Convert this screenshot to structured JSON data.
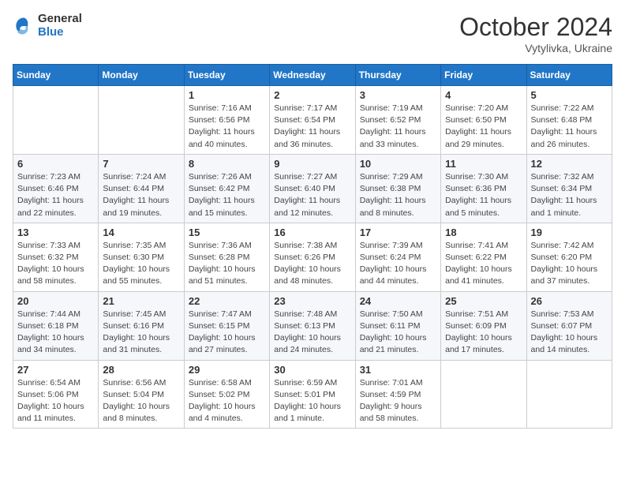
{
  "header": {
    "logo_general": "General",
    "logo_blue": "Blue",
    "month": "October 2024",
    "location": "Vytylivka, Ukraine"
  },
  "days_of_week": [
    "Sunday",
    "Monday",
    "Tuesday",
    "Wednesday",
    "Thursday",
    "Friday",
    "Saturday"
  ],
  "weeks": [
    [
      {
        "day": "",
        "info": ""
      },
      {
        "day": "",
        "info": ""
      },
      {
        "day": "1",
        "info": "Sunrise: 7:16 AM\nSunset: 6:56 PM\nDaylight: 11 hours and 40 minutes."
      },
      {
        "day": "2",
        "info": "Sunrise: 7:17 AM\nSunset: 6:54 PM\nDaylight: 11 hours and 36 minutes."
      },
      {
        "day": "3",
        "info": "Sunrise: 7:19 AM\nSunset: 6:52 PM\nDaylight: 11 hours and 33 minutes."
      },
      {
        "day": "4",
        "info": "Sunrise: 7:20 AM\nSunset: 6:50 PM\nDaylight: 11 hours and 29 minutes."
      },
      {
        "day": "5",
        "info": "Sunrise: 7:22 AM\nSunset: 6:48 PM\nDaylight: 11 hours and 26 minutes."
      }
    ],
    [
      {
        "day": "6",
        "info": "Sunrise: 7:23 AM\nSunset: 6:46 PM\nDaylight: 11 hours and 22 minutes."
      },
      {
        "day": "7",
        "info": "Sunrise: 7:24 AM\nSunset: 6:44 PM\nDaylight: 11 hours and 19 minutes."
      },
      {
        "day": "8",
        "info": "Sunrise: 7:26 AM\nSunset: 6:42 PM\nDaylight: 11 hours and 15 minutes."
      },
      {
        "day": "9",
        "info": "Sunrise: 7:27 AM\nSunset: 6:40 PM\nDaylight: 11 hours and 12 minutes."
      },
      {
        "day": "10",
        "info": "Sunrise: 7:29 AM\nSunset: 6:38 PM\nDaylight: 11 hours and 8 minutes."
      },
      {
        "day": "11",
        "info": "Sunrise: 7:30 AM\nSunset: 6:36 PM\nDaylight: 11 hours and 5 minutes."
      },
      {
        "day": "12",
        "info": "Sunrise: 7:32 AM\nSunset: 6:34 PM\nDaylight: 11 hours and 1 minute."
      }
    ],
    [
      {
        "day": "13",
        "info": "Sunrise: 7:33 AM\nSunset: 6:32 PM\nDaylight: 10 hours and 58 minutes."
      },
      {
        "day": "14",
        "info": "Sunrise: 7:35 AM\nSunset: 6:30 PM\nDaylight: 10 hours and 55 minutes."
      },
      {
        "day": "15",
        "info": "Sunrise: 7:36 AM\nSunset: 6:28 PM\nDaylight: 10 hours and 51 minutes."
      },
      {
        "day": "16",
        "info": "Sunrise: 7:38 AM\nSunset: 6:26 PM\nDaylight: 10 hours and 48 minutes."
      },
      {
        "day": "17",
        "info": "Sunrise: 7:39 AM\nSunset: 6:24 PM\nDaylight: 10 hours and 44 minutes."
      },
      {
        "day": "18",
        "info": "Sunrise: 7:41 AM\nSunset: 6:22 PM\nDaylight: 10 hours and 41 minutes."
      },
      {
        "day": "19",
        "info": "Sunrise: 7:42 AM\nSunset: 6:20 PM\nDaylight: 10 hours and 37 minutes."
      }
    ],
    [
      {
        "day": "20",
        "info": "Sunrise: 7:44 AM\nSunset: 6:18 PM\nDaylight: 10 hours and 34 minutes."
      },
      {
        "day": "21",
        "info": "Sunrise: 7:45 AM\nSunset: 6:16 PM\nDaylight: 10 hours and 31 minutes."
      },
      {
        "day": "22",
        "info": "Sunrise: 7:47 AM\nSunset: 6:15 PM\nDaylight: 10 hours and 27 minutes."
      },
      {
        "day": "23",
        "info": "Sunrise: 7:48 AM\nSunset: 6:13 PM\nDaylight: 10 hours and 24 minutes."
      },
      {
        "day": "24",
        "info": "Sunrise: 7:50 AM\nSunset: 6:11 PM\nDaylight: 10 hours and 21 minutes."
      },
      {
        "day": "25",
        "info": "Sunrise: 7:51 AM\nSunset: 6:09 PM\nDaylight: 10 hours and 17 minutes."
      },
      {
        "day": "26",
        "info": "Sunrise: 7:53 AM\nSunset: 6:07 PM\nDaylight: 10 hours and 14 minutes."
      }
    ],
    [
      {
        "day": "27",
        "info": "Sunrise: 6:54 AM\nSunset: 5:06 PM\nDaylight: 10 hours and 11 minutes."
      },
      {
        "day": "28",
        "info": "Sunrise: 6:56 AM\nSunset: 5:04 PM\nDaylight: 10 hours and 8 minutes."
      },
      {
        "day": "29",
        "info": "Sunrise: 6:58 AM\nSunset: 5:02 PM\nDaylight: 10 hours and 4 minutes."
      },
      {
        "day": "30",
        "info": "Sunrise: 6:59 AM\nSunset: 5:01 PM\nDaylight: 10 hours and 1 minute."
      },
      {
        "day": "31",
        "info": "Sunrise: 7:01 AM\nSunset: 4:59 PM\nDaylight: 9 hours and 58 minutes."
      },
      {
        "day": "",
        "info": ""
      },
      {
        "day": "",
        "info": ""
      }
    ]
  ]
}
